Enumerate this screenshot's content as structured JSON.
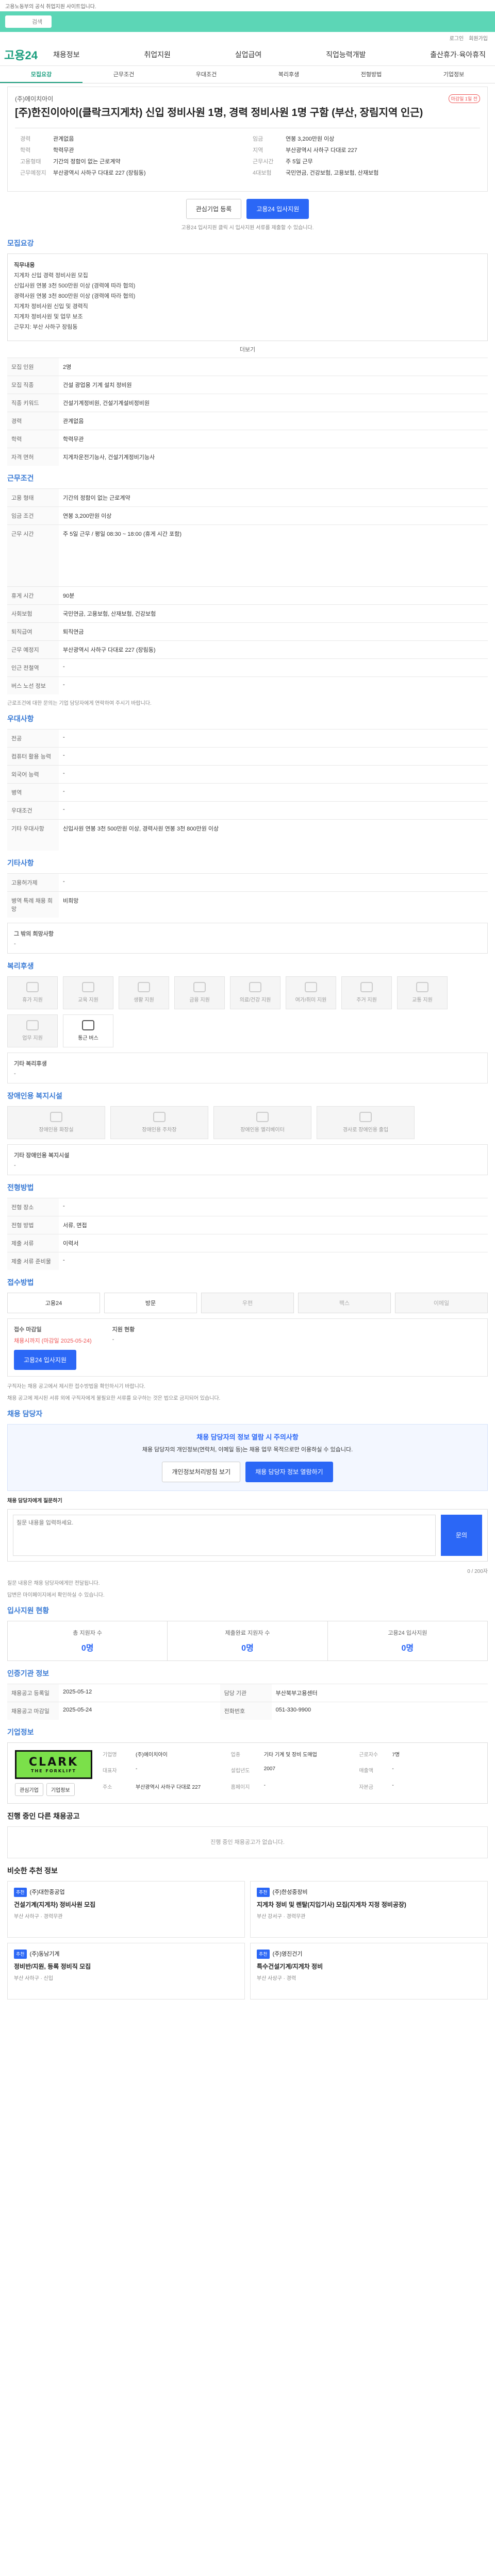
{
  "top": {
    "note": "고용노동부의 공식 취업지원 사이트입니다.",
    "search_placeholder": "검색",
    "links": [
      "로그인",
      "회원가입"
    ]
  },
  "gnb": {
    "logo": "고용24",
    "menu": [
      "채용정보",
      "취업지원",
      "실업급여",
      "직업능력개발",
      "출산휴가·육아휴직"
    ]
  },
  "tabs": [
    "모집요강",
    "근무조건",
    "우대조건",
    "복리후생",
    "전형방법",
    "기업정보"
  ],
  "header": {
    "company": "(주)에이치아이",
    "title": "[주)한진이아이(클락크지게차) 신입 정비사원 1명, 경력 정비사원 1명 구함 (부산, 장림지역 인근)",
    "deadline_badge": "마감일 1일 전",
    "left": [
      {
        "k": "경력",
        "v": "관계없음"
      },
      {
        "k": "학력",
        "v": "학력무관"
      },
      {
        "k": "고용형태",
        "v": "기간의 정함이 없는 근로계약"
      },
      {
        "k": "근무예정지",
        "v": "부산광역시 사하구 다대로 227 (장림동)"
      }
    ],
    "right": [
      {
        "k": "임금",
        "v": "연봉 3,200만원 이상"
      },
      {
        "k": "지역",
        "v": "부산광역시 사하구 다대로 227"
      },
      {
        "k": "근무시간",
        "v": "주 5일 근무"
      },
      {
        "k": "4대보험",
        "v": "국민연금, 건강보험, 고용보험, 산재보험"
      }
    ],
    "btn_interest": "관심기업 등록",
    "btn_apply": "고용24 입사지원",
    "apply_note": "고용24 입사지원 클릭 시 입사지원 서류를 제출할 수 있습니다."
  },
  "recruit": {
    "title": "모집요강",
    "body": [
      "직무내용",
      "지게차 신입 경력 정비사원 모집",
      "신입사원 연봉 3천 500만원 이상 (경력에 따라 협의)",
      "경력사원 연봉 3천 800만원 이상 (경력에 따라 협의)",
      "지게차 정비사원 신입 및 경력직",
      "지게차 정비사원 및 업무 보조",
      "",
      "근무지: 부산 사하구 장림동",
      "근무시간: 월~금 08:30 ~ 18:00"
    ],
    "more": "더보기",
    "rows": [
      {
        "k": "모집 인원",
        "v": "2명"
      },
      {
        "k": "모집 직종",
        "v": "건설 광업용 기계 설치 정비원"
      },
      {
        "k": "직종 키워드",
        "v": "건설기계정비원, 건설기계설비정비원"
      },
      {
        "k": "경력",
        "v": "관계없음"
      },
      {
        "k": "학력",
        "v": "학력무관"
      },
      {
        "k": "자격 면허",
        "v": "지게차운전기능사, 건설기계정비기능사"
      }
    ]
  },
  "conditions": {
    "title": "근무조건",
    "rows": [
      {
        "k": "고용 형태",
        "v": "기간의 정함이 없는 근로계약"
      },
      {
        "k": "임금 조건",
        "v": "연봉 3,200만원 이상"
      },
      {
        "k": "근무 시간",
        "v": "주 5일 근무 / 평일 08:30 ~ 18:00 (휴게 시간 포함)"
      },
      {
        "k": "휴게 시간",
        "v": "90분"
      },
      {
        "k": "사회보험",
        "v": "국민연금, 고용보험, 산재보험, 건강보험"
      },
      {
        "k": "퇴직급여",
        "v": "퇴직연금"
      },
      {
        "k": "근무 예정지",
        "v": "부산광역시 사하구 다대로 227 (장림동)"
      },
      {
        "k": "인근 전철역",
        "v": "-"
      },
      {
        "k": "버스 노선 정보",
        "v": "-"
      }
    ],
    "note": "근로조건에 대한 문의는 기업 담당자에게 연락하여 주시기 바랍니다."
  },
  "preferred": {
    "title": "우대사항",
    "rows": [
      {
        "k": "전공",
        "v": "-"
      },
      {
        "k": "컴퓨터 활용 능력",
        "v": "-"
      },
      {
        "k": "외국어 능력",
        "v": "-"
      },
      {
        "k": "병역",
        "v": "-"
      },
      {
        "k": "우대조건",
        "v": "-"
      },
      {
        "k": "기타 우대사항",
        "v": "신입사원 연봉 3천 500만원 이상, 경력사원 연봉 3천 800만원 이상"
      }
    ]
  },
  "other": {
    "title": "기타사항",
    "rows": [
      {
        "k": "고용허가제",
        "v": "-"
      },
      {
        "k": "병역 특례 채용 희망",
        "v": "비희망"
      }
    ],
    "extra_label": "그 밖의 희망사항",
    "extra_value": "-"
  },
  "welfare": {
    "title": "복리후생",
    "items": [
      "휴가 지원",
      "교육 지원",
      "생활 지원",
      "금융 지원",
      "의료/건강 지원",
      "여가/취미 지원",
      "주거 지원",
      "교통 지원",
      "업무 지원",
      "통근 버스"
    ],
    "other_label": "기타 복리후생",
    "other_value": "-"
  },
  "disabled": {
    "title": "장애인용 복지시설",
    "items": [
      "장애인용 화장실",
      "장애인용 주차장",
      "장애인용 엘리베이터",
      "경사로 장애인용 출입"
    ],
    "other_label": "기타 장애인용 복지시설",
    "other_value": "-"
  },
  "process": {
    "title": "전형방법",
    "rows": [
      {
        "k": "전형 장소",
        "v": "-"
      },
      {
        "k": "전형 방법",
        "v": "서류, 면접"
      },
      {
        "k": "제출 서류",
        "v": "이력서"
      },
      {
        "k": "제출 서류 준비물",
        "v": "-"
      }
    ]
  },
  "apply": {
    "title": "접수방법",
    "methods": [
      "고용24",
      "방문",
      "우편",
      "팩스",
      "이메일"
    ],
    "deadline_label": "접수 마감일",
    "deadline_value": "채용시까지 (마감일 2025-05-24)",
    "applicants_label": "지원 현황",
    "applicants_value": "-",
    "btn_apply": "고용24 입사지원",
    "notes": [
      "구직자는 채용 공고에서 제시한 접수방법을 확인하시기 바랍니다.",
      "채용 공고에 제시된 서류 외에 구직자에게 불필요한 서류를 요구하는 것은 법으로 금지되어 있습니다."
    ]
  },
  "contact": {
    "title": "채용 담당자",
    "box_title": "채용 담당자의 정보 열람 시 주의사항",
    "box_text": "채용 담당자의 개인정보(연락처, 이메일 등)는 채용 업무 목적으로만 이용하실 수 있습니다.",
    "btn1": "개인정보처리방침 보기",
    "btn2": "채용 담당자 정보 열람하기",
    "qa_label": "채용 담당자에게 질문하기",
    "qa_placeholder": "질문 내용을 입력하세요.",
    "qa_send": "문의",
    "qa_count": "0 / 200자",
    "notes": [
      "질문 내용은 채용 담당자에게만 전달됩니다.",
      "답변은 마이페이지에서 확인하실 수 있습니다."
    ]
  },
  "stats": {
    "title": "입사지원 현황",
    "items": [
      {
        "label": "총 지원자 수",
        "value": "0명"
      },
      {
        "label": "제출완료 지원자 수",
        "value": "0명"
      },
      {
        "label": "고용24 입사지원",
        "value": "0명"
      }
    ]
  },
  "agency": {
    "title": "인증기관 정보",
    "rows": [
      {
        "k": "채용공고 등록일",
        "v": "2025-05-12",
        "k2": "담당 기관",
        "v2": "부산북부고용센터"
      },
      {
        "k": "채용공고 마감일",
        "v": "2025-05-24",
        "k2": "전화번호",
        "v2": "051-330-9900"
      }
    ]
  },
  "company": {
    "title": "기업정보",
    "logo_big": "CLARK",
    "logo_small": "THE FORKLIFT",
    "btn_interest": "관심기업",
    "btn_more": "기업정보",
    "fields": [
      {
        "k": "기업명",
        "v": "(주)에이치아이"
      },
      {
        "k": "업종",
        "v": "기타 기계 및 장비 도매업"
      },
      {
        "k": "근로자수",
        "v": "7명"
      },
      {
        "k": "대표자",
        "v": "-"
      },
      {
        "k": "설립년도",
        "v": "2007"
      },
      {
        "k": "매출액",
        "v": "-"
      },
      {
        "k": "주소",
        "v": "부산광역시 사하구 다대로 227"
      },
      {
        "k": "홈페이지",
        "v": "-"
      },
      {
        "k": "자본금",
        "v": "-"
      }
    ]
  },
  "open_jobs": {
    "title": "진행 중인 다른 채용공고",
    "empty": "진행 중인 채용공고가 없습니다."
  },
  "recommend": {
    "title": "비슷한 추천 정보",
    "cards": [
      {
        "tag": "추천",
        "company": "(주)대한중공업",
        "title": "건설기계(지게차) 정비사원 모집",
        "meta": "부산 사하구 · 경력무관"
      },
      {
        "tag": "추천",
        "company": "(주)한성중장비",
        "title": "지게차 정비 및 렌탈(지입기사) 모집(지게차 지정 정비공장)",
        "meta": "부산 강서구 · 경력무관"
      },
      {
        "tag": "추천",
        "company": "(주)동남기계",
        "title": "정비반/지원, 등록 정비직 모집",
        "meta": "부산 사하구 · 신입"
      },
      {
        "tag": "추천",
        "company": "(주)영진건기",
        "title": "특수건설기계/지게차 정비",
        "meta": "부산 사상구 · 경력"
      }
    ]
  }
}
